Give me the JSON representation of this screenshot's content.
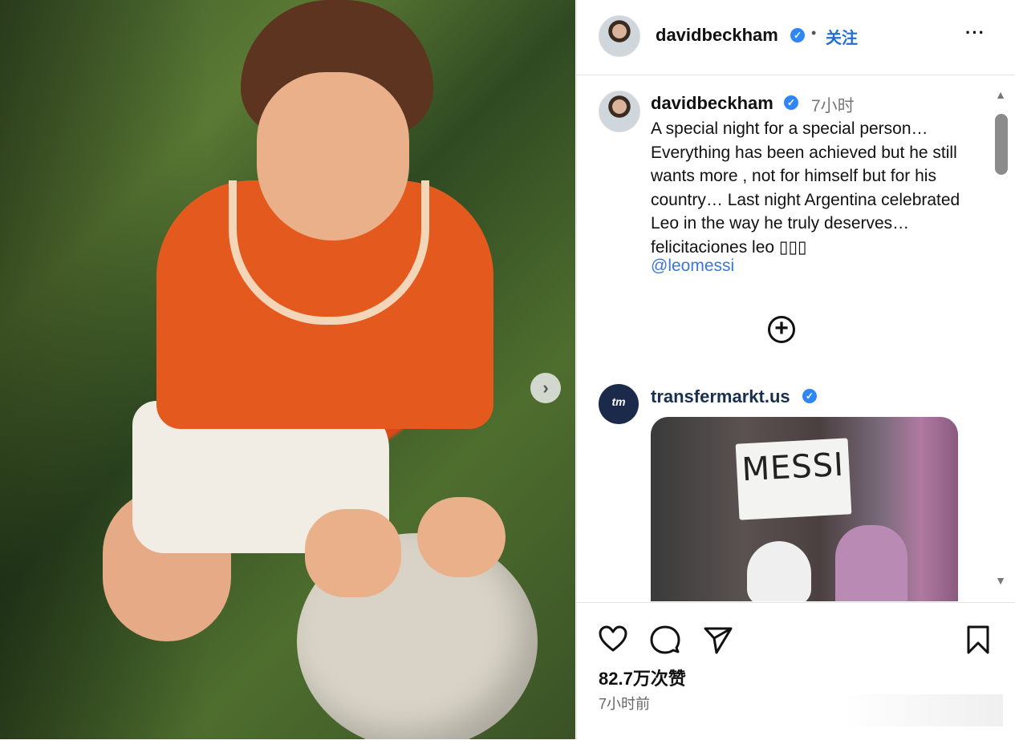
{
  "post": {
    "username": "davidbeckham",
    "follow_label": "关注",
    "separator": "•",
    "more_label": "···"
  },
  "caption": {
    "username": "davidbeckham",
    "time": "7小时",
    "text": "A special night for a special person… Everything has been achieved but he still wants more , not for himself but for his country… Last night Argentina celebrated Leo in the way he truly deserves… felicitaciones leo ▯▯▯",
    "mention": "@leomessi"
  },
  "comment": {
    "avatar_text": "tm",
    "username": "transfermarkt.us",
    "image_sign_text": "MESSI"
  },
  "actions": {
    "likes": "82.7万次赞",
    "posted_time": "7小时前"
  },
  "colors": {
    "verified": "#2f86f6",
    "follow": "#1f6fd6",
    "mention": "#3b76d6"
  },
  "icons": [
    "chevron-right-icon",
    "more-icon",
    "verified-icon",
    "add-circle-icon",
    "heart-icon",
    "comment-icon",
    "share-icon",
    "bookmark-icon"
  ]
}
